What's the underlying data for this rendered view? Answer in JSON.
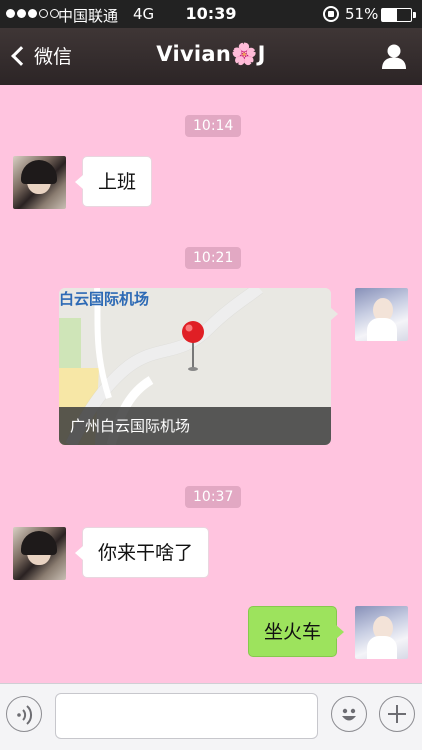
{
  "status_bar": {
    "carrier": "中国联通",
    "network": "4G",
    "time": "10:39",
    "battery_percent": "51%",
    "battery_level": 0.51,
    "signal_bars_filled": 3,
    "signal_bars_total": 5
  },
  "nav": {
    "back_label": "微信",
    "title": "Vivian🌸J"
  },
  "messages": {
    "t1": "10:14",
    "m1": "上班",
    "t2": "10:21",
    "location_name": "白云国际机场",
    "location_caption": "广州白云国际机场",
    "t3": "10:37",
    "m2": "你来干啥了",
    "m3": "坐火车"
  },
  "input": {
    "placeholder": ""
  },
  "colors": {
    "chat_background": "#ffc4df",
    "sent_bubble": "#9de35d",
    "received_bubble": "#ffffff",
    "time_chip": "#e2a8c3",
    "nav_bar": "#342c2d"
  }
}
